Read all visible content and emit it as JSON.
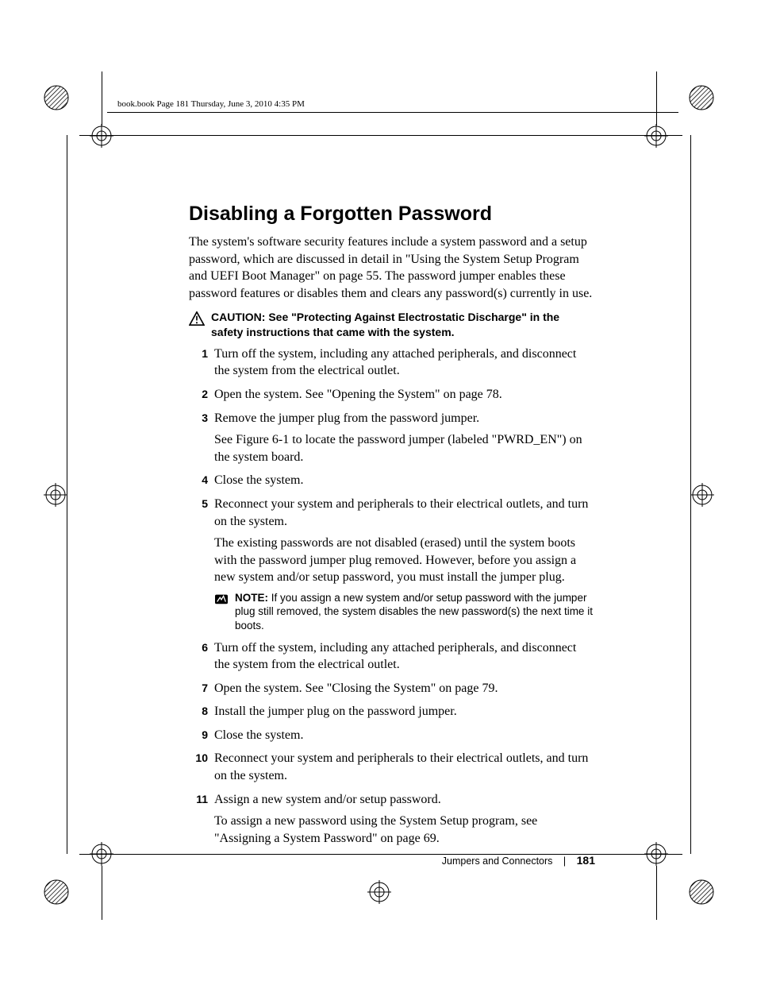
{
  "header": {
    "running": "book.book  Page 181  Thursday, June 3, 2010  4:35 PM"
  },
  "title": "Disabling a Forgotten Password",
  "intro": "The system's software security features include a system password and a setup password, which are discussed in detail in \"Using the System Setup Program and UEFI Boot Manager\" on page 55. The password jumper enables these password features or disables them and clears any password(s) currently in use.",
  "caution": {
    "label": "CAUTION: ",
    "text": "See \"Protecting Against Electrostatic Discharge\" in the safety instructions that came with the system."
  },
  "steps": [
    {
      "text": "Turn off the system, including any attached peripherals, and disconnect the system from the electrical outlet."
    },
    {
      "text": "Open the system. See \"Opening the System\" on page 78."
    },
    {
      "text": "Remove the jumper plug from the password jumper.",
      "para": "See Figure 6-1 to locate the password jumper (labeled \"PWRD_EN\") on the system board."
    },
    {
      "text": "Close the system."
    },
    {
      "text": "Reconnect your system and peripherals to their electrical outlets, and turn on the system.",
      "para": "The existing passwords are not disabled (erased) until the system boots with the password jumper plug removed. However, before you assign a new system and/or setup password, you must install the jumper plug.",
      "note": {
        "label": "NOTE: ",
        "text": "If you assign a new system and/or setup password with the jumper plug still removed, the system disables the new password(s) the next time it boots."
      }
    },
    {
      "text": "Turn off the system, including any attached peripherals, and disconnect the system from the electrical outlet."
    },
    {
      "text": "Open the system. See \"Closing the System\" on page 79."
    },
    {
      "text": "Install the jumper plug on the password jumper."
    },
    {
      "text": "Close the system."
    },
    {
      "text": "Reconnect your system and peripherals to their electrical outlets, and turn on the system."
    },
    {
      "text": "Assign a new system and/or setup password.",
      "para": "To assign a new password using the System Setup program, see \"Assigning a System Password\" on page 69."
    }
  ],
  "footer": {
    "section": "Jumpers and Connectors",
    "page": "181"
  },
  "icons": {
    "caution": "caution-triangle-icon",
    "note": "note-pencil-icon",
    "reg": "registration-mark-icon",
    "hatch": "hatched-circle-icon"
  }
}
